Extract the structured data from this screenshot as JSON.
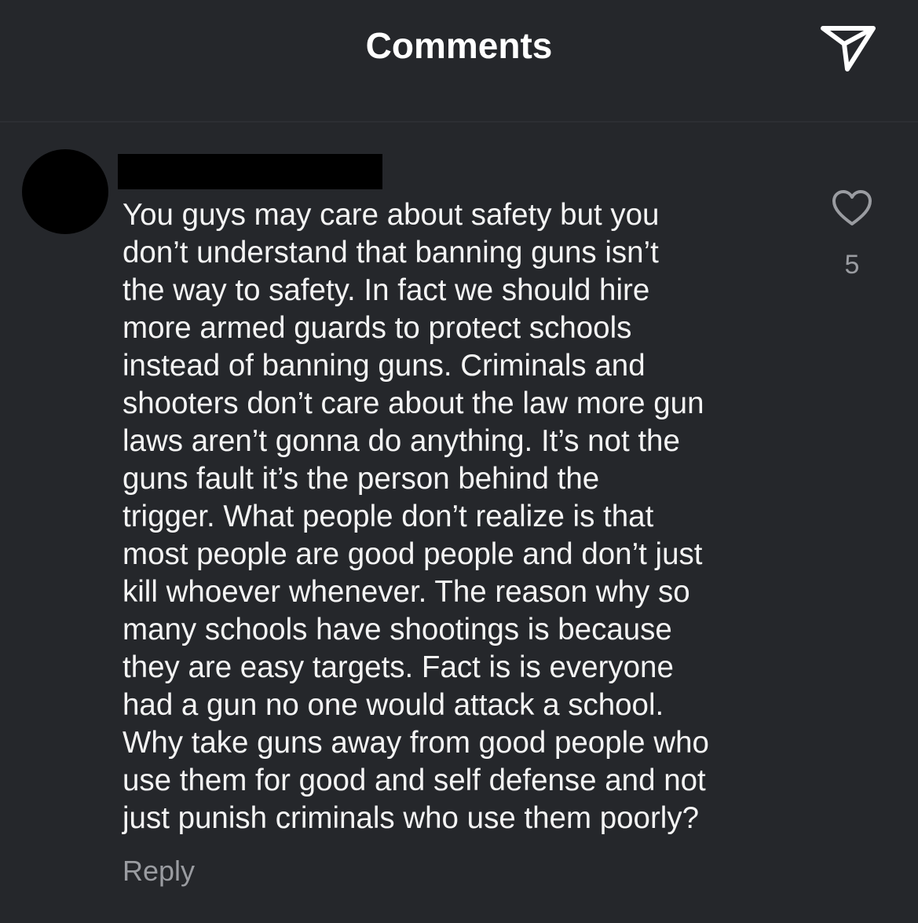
{
  "header": {
    "title": "Comments",
    "share_icon": "send-icon"
  },
  "comment": {
    "avatar": "avatar-redacted",
    "username": "",
    "text": "You guys may care about safety but you\ndon’t understand that banning guns isn’t\nthe way to safety. In fact we should hire\nmore armed guards to protect schools\ninstead of banning guns. Criminals and\nshooters don’t care about the law more gun\nlaws aren’t gonna do anything. It’s not the\nguns fault it’s the person behind the\ntrigger. What people don’t realize is that\nmost people are good people and don’t just\nkill whoever whenever.  The reason why so\nmany schools have shootings is because\nthey are easy targets. Fact is is everyone\nhad a gun no one would attack a school.\nWhy take guns away from good people who\nuse them for good and self defense and not\njust punish criminals who use them poorly?",
    "reply_label": "Reply",
    "like_icon": "heart-outline-icon",
    "like_count": "5"
  },
  "colors": {
    "background": "#25272b",
    "text": "#f4f4f4",
    "secondary_text": "#9a9ca1"
  }
}
